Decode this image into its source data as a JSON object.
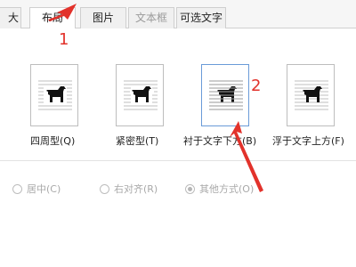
{
  "tabs": [
    {
      "label": "大小",
      "active": false,
      "disabled": false
    },
    {
      "label": "布局",
      "active": true,
      "disabled": false
    },
    {
      "label": "图片",
      "active": false,
      "disabled": false
    },
    {
      "label": "文本框",
      "active": false,
      "disabled": true
    },
    {
      "label": "可选文字",
      "active": false,
      "disabled": false
    }
  ],
  "wrap_styles": [
    {
      "label": "四周型(Q)",
      "icon": "dog-square-wrap-icon"
    },
    {
      "label": "紧密型(T)",
      "icon": "dog-tight-wrap-icon"
    },
    {
      "label": "衬于文字下方(B)",
      "icon": "dog-behind-text-icon",
      "selected": true
    },
    {
      "label": "浮于文字上方(F)",
      "icon": "dog-in-front-of-text-icon"
    }
  ],
  "alignment": [
    {
      "label": "居中(C)",
      "checked": false
    },
    {
      "label": "右对齐(R)",
      "checked": false
    },
    {
      "label": "其他方式(O)",
      "checked": true
    }
  ],
  "annotations": {
    "one": "1",
    "two": "2"
  },
  "colors": {
    "annotation_red": "#e2322b",
    "tab_border": "#cfcfcf"
  }
}
